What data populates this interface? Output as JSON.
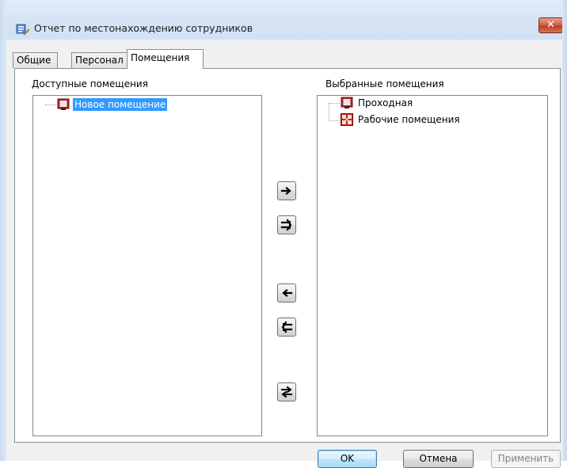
{
  "window": {
    "title": "Отчет по местонахождению сотрудников",
    "close_label": "✕"
  },
  "tabs": [
    {
      "label": "Общие",
      "active": false
    },
    {
      "label": "Персонал",
      "active": false
    },
    {
      "label": "Помещения",
      "active": true
    }
  ],
  "available": {
    "label": "Доступные помещения",
    "items": [
      {
        "label": "Новое помещение",
        "icon": "room-icon",
        "selected": true
      }
    ]
  },
  "selected": {
    "label": "Выбранные помещения",
    "items": [
      {
        "label": "Проходная",
        "icon": "room-icon",
        "selected": false
      },
      {
        "label": "Рабочие помещения",
        "icon": "room-group-icon",
        "selected": false
      }
    ]
  },
  "transfer_buttons": [
    {
      "name": "move-right-button",
      "icon": "arrow-right-icon"
    },
    {
      "name": "move-all-right-button",
      "icon": "double-arrow-right-icon"
    },
    {
      "name": "move-left-button",
      "icon": "arrow-left-icon"
    },
    {
      "name": "move-all-left-button",
      "icon": "double-arrow-left-icon"
    },
    {
      "name": "swap-button",
      "icon": "swap-arrows-icon"
    }
  ],
  "buttons": {
    "ok": "OK",
    "cancel": "Отмена",
    "apply": "Применить"
  },
  "colors": {
    "selection": "#3399ff",
    "room_icon": "#b22222",
    "close_button": "#c94a32"
  }
}
